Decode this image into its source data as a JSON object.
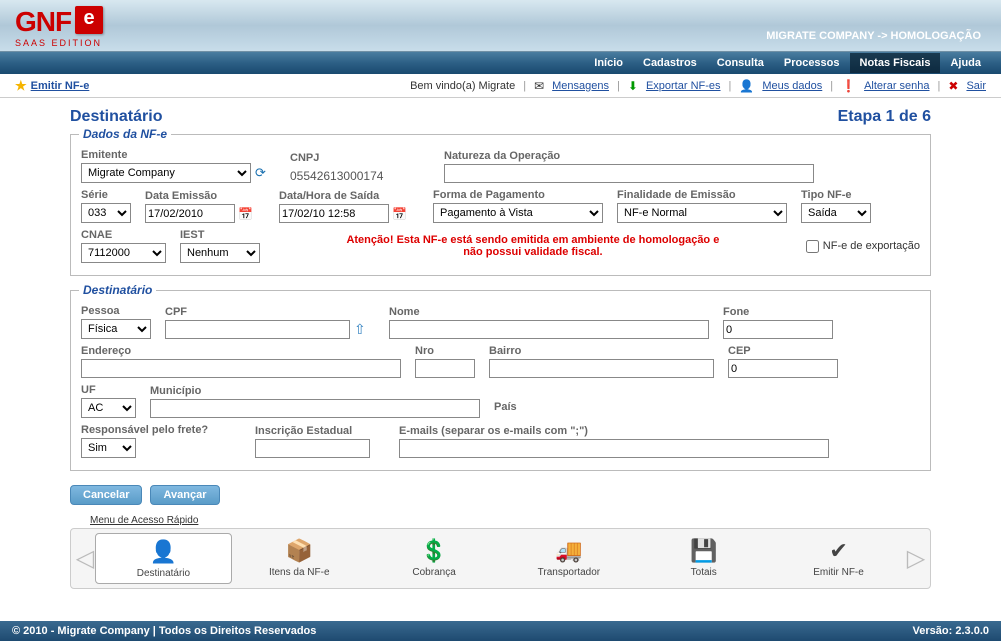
{
  "company_header": "MIGRATE COMPANY -> HOMOLOGAÇÃO",
  "logo": {
    "text": "GNF",
    "e": "e",
    "sub": "SAAS EDITION"
  },
  "mainmenu": {
    "inicio": "Início",
    "cadastros": "Cadastros",
    "consulta": "Consulta",
    "processos": "Processos",
    "notas": "Notas Fiscais",
    "ajuda": "Ajuda"
  },
  "subbar": {
    "emitir": "Emitir NF-e",
    "welcome": "Bem vindo(a) Migrate",
    "mensagens": "Mensagens",
    "exportar": "Exportar NF-es",
    "meusdados": "Meus dados",
    "alterarsenha": "Alterar senha",
    "sair": "Sair"
  },
  "page_title": "Destinatário",
  "step_label": "Etapa 1 de 6",
  "fs1": {
    "legend": "Dados da NF-e",
    "emitente_label": "Emitente",
    "emitente_value": "Migrate Company",
    "cnpj_label": "CNPJ",
    "cnpj_value": "05542613000174",
    "natureza_label": "Natureza da Operação",
    "natureza_value": "",
    "serie_label": "Série",
    "serie_value": "033",
    "dataemissao_label": "Data Emissão",
    "dataemissao_value": "17/02/2010",
    "datasaida_label": "Data/Hora de Saída",
    "datasaida_value": "17/02/10 12:58",
    "formapag_label": "Forma de Pagamento",
    "formapag_value": "Pagamento à Vista",
    "finalidade_label": "Finalidade de Emissão",
    "finalidade_value": "NF-e Normal",
    "tiponfe_label": "Tipo NF-e",
    "tiponfe_value": "Saída",
    "cnae_label": "CNAE",
    "cnae_value": "7112000",
    "iest_label": "IEST",
    "iest_value": "Nenhum",
    "warn1": "Atenção! Esta NF-e está sendo emitida em ambiente de homologação e",
    "warn2": "não possui validade fiscal.",
    "export_label": "NF-e de exportação"
  },
  "fs2": {
    "legend": "Destinatário",
    "pessoa_label": "Pessoa",
    "pessoa_value": "Física",
    "cpf_label": "CPF",
    "cpf_value": "",
    "nome_label": "Nome",
    "nome_value": "",
    "fone_label": "Fone",
    "fone_value": "0",
    "endereco_label": "Endereço",
    "endereco_value": "",
    "nro_label": "Nro",
    "nro_value": "",
    "bairro_label": "Bairro",
    "bairro_value": "",
    "cep_label": "CEP",
    "cep_value": "0",
    "uf_label": "UF",
    "uf_value": "AC",
    "municipio_label": "Município",
    "municipio_value": "",
    "pais_label": "País",
    "pais_value": "",
    "frete_label": "Responsável pelo frete?",
    "frete_value": "Sim",
    "ie_label": "Inscrição Estadual",
    "ie_value": "",
    "emails_label": "E-mails  (separar os e-mails com \";\")",
    "emails_value": ""
  },
  "buttons": {
    "cancelar": "Cancelar",
    "avancar": "Avançar"
  },
  "quickmenu": {
    "label": "Menu de Acesso Rápido",
    "items": [
      {
        "label": "Destinatário",
        "icon": "👤"
      },
      {
        "label": "Itens da NF-e",
        "icon": "📦"
      },
      {
        "label": "Cobrança",
        "icon": "💲"
      },
      {
        "label": "Transportador",
        "icon": "🚚"
      },
      {
        "label": "Totais",
        "icon": "💾"
      },
      {
        "label": "Emitir NF-e",
        "icon": "✔"
      }
    ]
  },
  "footer": {
    "copyright": "© 2010 - Migrate Company | Todos os Direitos Reservados",
    "version": "Versão: 2.3.0.0"
  }
}
